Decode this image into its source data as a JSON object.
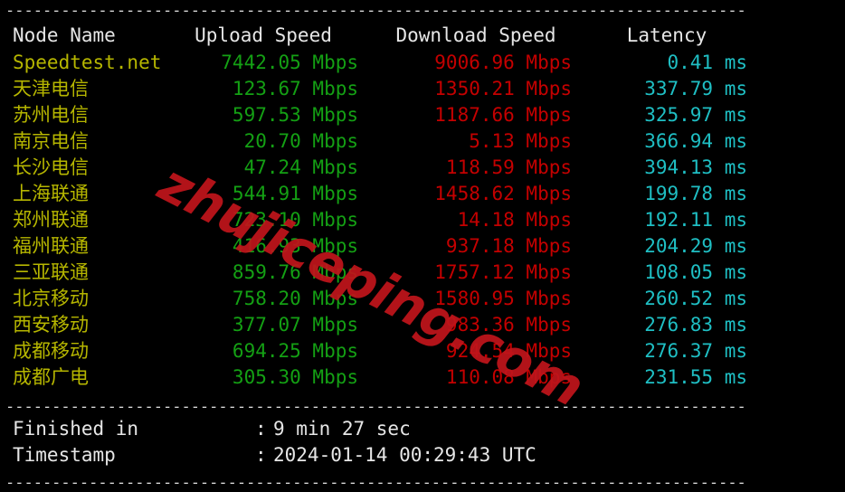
{
  "terminal": {
    "separator": "--------------------------------------------------------------------------------",
    "watermark": "zhujiceping.com"
  },
  "table": {
    "headers": {
      "node": "Node Name",
      "upload": "Upload Speed",
      "download": "Download Speed",
      "latency": "Latency"
    },
    "rows": [
      {
        "node": "Speedtest.net",
        "upload": "7442.05 Mbps",
        "download": "9006.96 Mbps",
        "latency": "0.41 ms"
      },
      {
        "node": "天津电信",
        "upload": "123.67 Mbps",
        "download": "1350.21 Mbps",
        "latency": "337.79 ms"
      },
      {
        "node": "苏州电信",
        "upload": "597.53 Mbps",
        "download": "1187.66 Mbps",
        "latency": "325.97 ms"
      },
      {
        "node": "南京电信",
        "upload": "20.70 Mbps",
        "download": "5.13 Mbps",
        "latency": "366.94 ms"
      },
      {
        "node": "长沙电信",
        "upload": "47.24 Mbps",
        "download": "118.59 Mbps",
        "latency": "394.13 ms"
      },
      {
        "node": "上海联通",
        "upload": "544.91 Mbps",
        "download": "1458.62 Mbps",
        "latency": "199.78 ms"
      },
      {
        "node": "郑州联通",
        "upload": "723.10 Mbps",
        "download": "14.18 Mbps",
        "latency": "192.11 ms"
      },
      {
        "node": "福州联通",
        "upload": "416.93 Mbps",
        "download": "937.18 Mbps",
        "latency": "204.29 ms"
      },
      {
        "node": "三亚联通",
        "upload": "859.76 Mbps",
        "download": "1757.12 Mbps",
        "latency": "108.05 ms"
      },
      {
        "node": "北京移动",
        "upload": "758.20 Mbps",
        "download": "1580.95 Mbps",
        "latency": "260.52 ms"
      },
      {
        "node": "西安移动",
        "upload": "377.07 Mbps",
        "download": "983.36 Mbps",
        "latency": "276.83 ms"
      },
      {
        "node": "成都移动",
        "upload": "694.25 Mbps",
        "download": "924.54 Mbps",
        "latency": "276.37 ms"
      },
      {
        "node": "成都广电",
        "upload": "305.30 Mbps",
        "download": "110.08 Mbps",
        "latency": "231.55 ms"
      }
    ]
  },
  "summary": {
    "finished_label": "Finished in",
    "finished_colon": ":",
    "finished_value": "9 min 27 sec",
    "timestamp_label": "Timestamp",
    "timestamp_colon": ":",
    "timestamp_value": "2024-01-14 00:29:43 UTC"
  },
  "colors": {
    "background": "#000000",
    "header_text": "#e6e6e6",
    "node_text": "#b6b600",
    "upload_text": "#14a014",
    "download_text": "#c40000",
    "latency_text": "#1fbfc4",
    "watermark": "#c0151b"
  }
}
